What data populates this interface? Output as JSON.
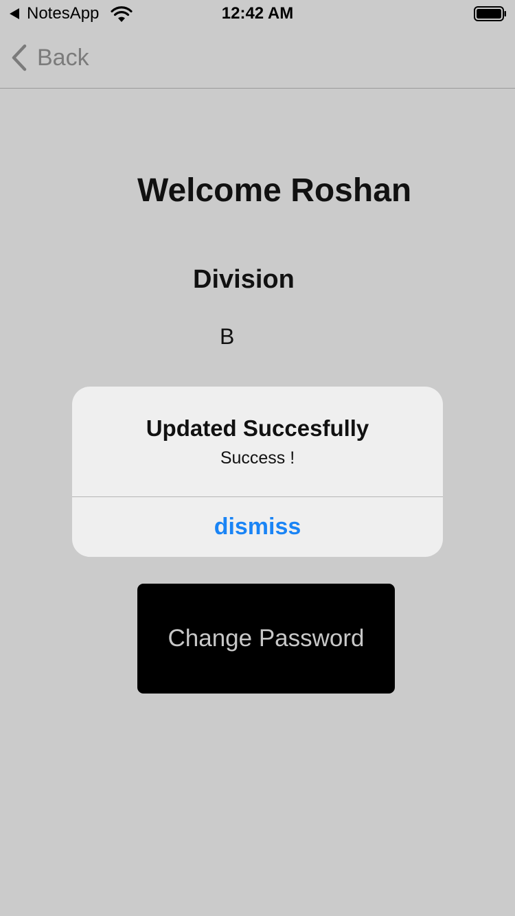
{
  "status_bar": {
    "app_name": "NotesApp",
    "time": "12:42 AM",
    "back_arrow_icon": "back-triangle-icon",
    "wifi_icon": "wifi-icon",
    "battery_icon": "battery-icon"
  },
  "nav": {
    "back_label": "Back",
    "back_icon": "chevron-left-icon"
  },
  "content": {
    "welcome": "Welcome Roshan",
    "division_label": "Division",
    "division_value": "B"
  },
  "alert": {
    "title": "Updated Succesfully",
    "message": "Success !",
    "button_label": "dismiss"
  },
  "change_password": {
    "label": "Change Password"
  },
  "colors": {
    "background": "#cbcbcb",
    "alert_background": "#efefef",
    "alert_button": "#1a84f5",
    "button_background": "#000000",
    "button_text": "#c8c8c8",
    "back_text": "#7b7b7b"
  }
}
